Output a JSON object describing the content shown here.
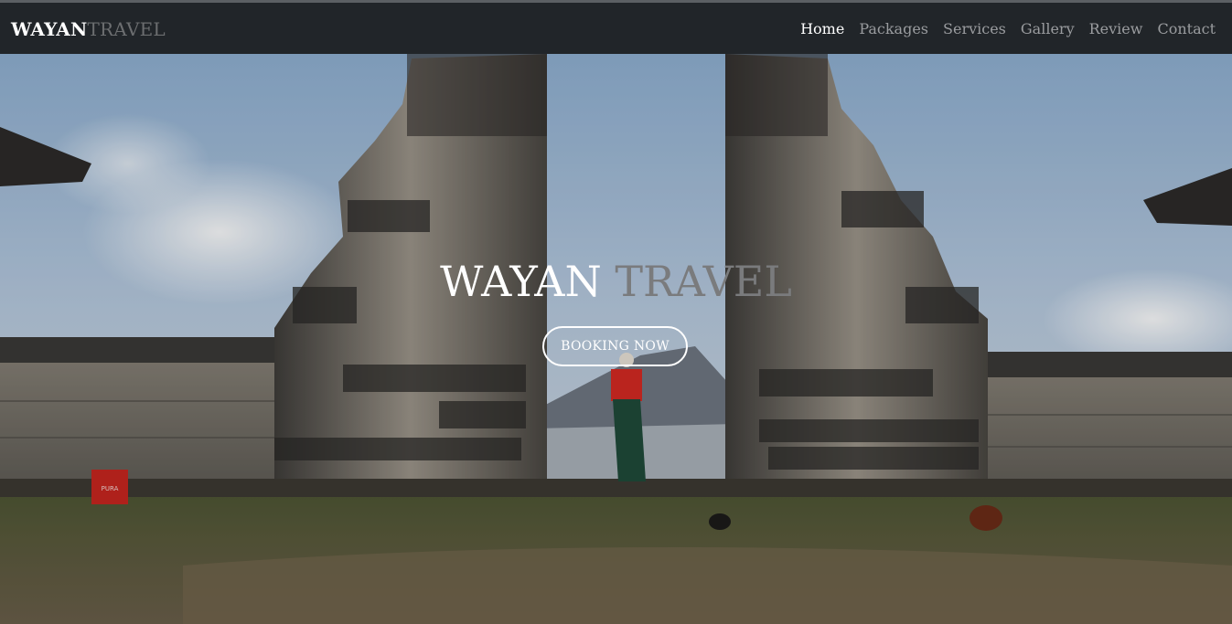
{
  "brand": {
    "part1": "WAYAN",
    "part2": "TRAVEL"
  },
  "nav": {
    "items": [
      {
        "label": "Home",
        "active": true
      },
      {
        "label": "Packages",
        "active": false
      },
      {
        "label": "Services",
        "active": false
      },
      {
        "label": "Gallery",
        "active": false
      },
      {
        "label": "Review",
        "active": false
      },
      {
        "label": "Contact",
        "active": false
      }
    ]
  },
  "hero": {
    "title_part1": "WAYAN",
    "title_part2": "TRAVEL",
    "cta_label": "BOOKING NOW",
    "sign_text": "PURA"
  },
  "colors": {
    "navbar_bg": "#212529",
    "nav_active": "#ffffff",
    "nav_inactive": "#9a9c9f",
    "brand_muted": "#6c6e70"
  }
}
